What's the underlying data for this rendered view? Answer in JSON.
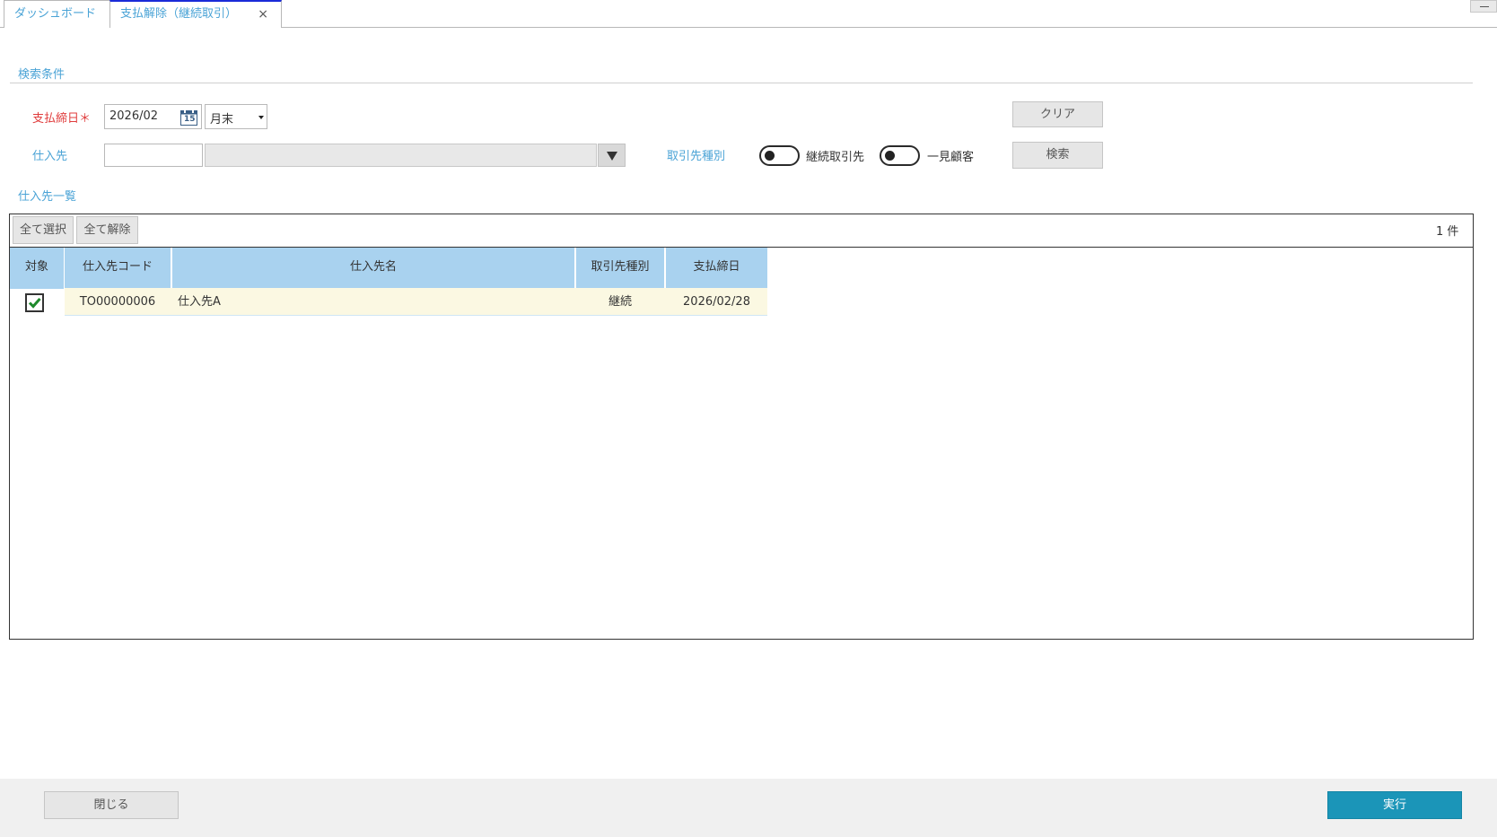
{
  "tabs": [
    {
      "label": "ダッシュボード"
    },
    {
      "label": "支払解除（継続取引）",
      "close": "×"
    }
  ],
  "search": {
    "section_title": "検索条件",
    "closing_date_label": "支払締日＊",
    "closing_date_value": "2026/02",
    "calendar_day": "15",
    "closing_day_select": "月末",
    "supplier_label": "仕入先",
    "supplier_code_value": "",
    "supplier_name_value": "",
    "partner_type_label": "取引先種別",
    "toggle_continuous_label": "継続取引先",
    "toggle_onetime_label": "一見顧客",
    "clear_button": "クリア",
    "search_button": "検索"
  },
  "list": {
    "section_title": "仕入先一覧",
    "select_all_button": "全て選択",
    "deselect_all_button": "全て解除",
    "count": "1 件",
    "columns": [
      "対象",
      "仕入先コード",
      "仕入先名",
      "取引先種別",
      "支払締日"
    ],
    "rows": [
      {
        "selected": true,
        "code": "TO00000006",
        "name": "仕入先A",
        "type": "継続",
        "closing_date": "2026/02/28"
      }
    ]
  },
  "footer": {
    "close_button": "閉じる",
    "execute_button": "実行"
  },
  "colors": {
    "accent_blue": "#4aa3d6",
    "required_red": "#e03c3c",
    "header_blue": "#a9d2ef",
    "row_yellow": "#fbf8e2",
    "execute_teal": "#1b95b8"
  }
}
